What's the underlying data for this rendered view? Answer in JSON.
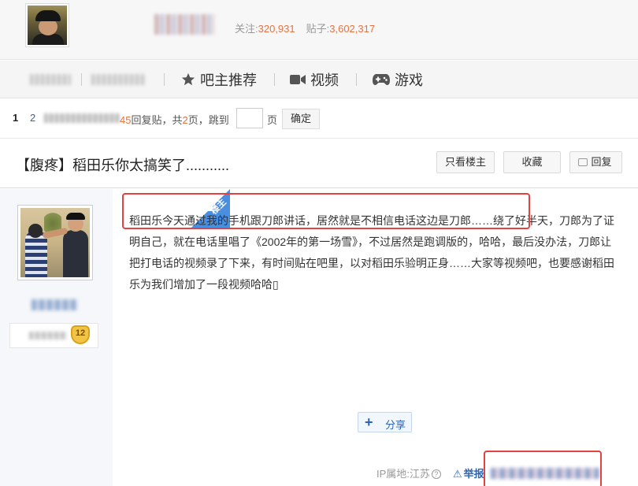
{
  "forum": {
    "follow_label": "关注:",
    "follow_count": "320,931",
    "posts_label": "贴子:",
    "posts_count": "3,602,317"
  },
  "nav": {
    "items": [
      {
        "label": "吧主推荐",
        "icon": "star-icon"
      },
      {
        "label": "视频",
        "icon": "video-camera-icon"
      },
      {
        "label": "游戏",
        "icon": "gamepad-icon"
      }
    ]
  },
  "pager": {
    "current_page": "1",
    "page_2": "2",
    "reply_count_tail": "45",
    "reply_suffix": "回复贴，共",
    "total_pages": "2",
    "pages_suffix": "页，跳到",
    "page_label": "页",
    "confirm": "确定"
  },
  "thread": {
    "title": "【腹疼】稻田乐你太搞笑了...........",
    "only_author": "只看楼主",
    "favorite": "收藏",
    "reply": "回复"
  },
  "post": {
    "badge": "楼主",
    "level": "12",
    "body": "稻田乐今天通过我的手机跟刀郎讲话，居然就是不相信电话这边是刀郎……绕了好半天，刀郎为了证明自己，就在电话里唱了《2002年的第一场雪》，不过居然是跑调版的，哈哈，最后没办法，刀郎让把打电话的视频录了下来，有时间贴在吧里，以对稻田乐验明正身……大家等视频吧，也要感谢稻田乐为我们增加了一段视频哈哈▯",
    "share": "分享",
    "ip_location": "IP属地:江苏",
    "report": "举报"
  },
  "colors": {
    "accent_orange": "#e3733f",
    "link_blue": "#2d64b3",
    "highlight_red": "#e24242"
  }
}
